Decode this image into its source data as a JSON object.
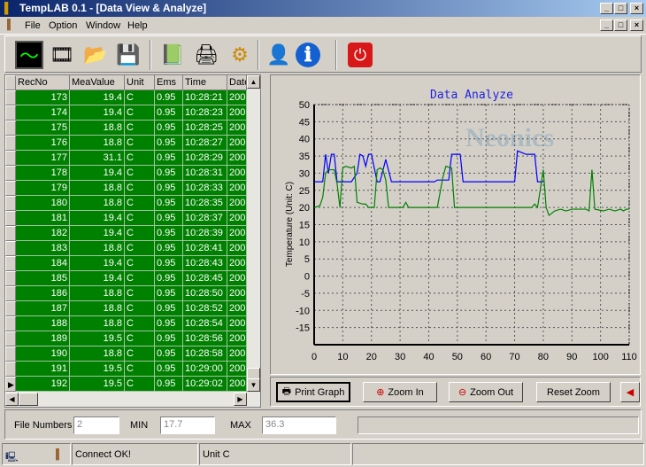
{
  "window": {
    "title": "TempLAB 0.1  - [Data View & Analyze]",
    "controls": [
      "_",
      "□",
      "×"
    ]
  },
  "menu": [
    "File",
    "Option",
    "Window",
    "Help"
  ],
  "toolbar": [
    {
      "icon": "oscilloscope-icon",
      "glyph": "〜"
    },
    {
      "icon": "film-reel-icon",
      "glyph": "🎞"
    },
    {
      "icon": "open-folder-icon",
      "glyph": "📂"
    },
    {
      "icon": "save-disk-icon",
      "glyph": "💾"
    },
    {
      "icon": "excel-export-icon",
      "glyph": "📗"
    },
    {
      "icon": "printer-icon",
      "glyph": "🖨"
    },
    {
      "icon": "settings-gears-icon",
      "glyph": "⚙"
    },
    {
      "icon": "user-report-icon",
      "glyph": "👤"
    },
    {
      "icon": "info-icon",
      "glyph": "ℹ"
    },
    {
      "icon": "power-icon",
      "glyph": "⏻"
    }
  ],
  "grid": {
    "columns": [
      "RecNo",
      "MeaValue",
      "Unit",
      "Ems",
      "Time",
      "Date"
    ],
    "rows": [
      [
        "173",
        "19.4",
        "C",
        "0.95",
        "10:28:21",
        "200"
      ],
      [
        "174",
        "19.4",
        "C",
        "0.95",
        "10:28:23",
        "200"
      ],
      [
        "175",
        "18.8",
        "C",
        "0.95",
        "10:28:25",
        "200"
      ],
      [
        "176",
        "18.8",
        "C",
        "0.95",
        "10:28:27",
        "200"
      ],
      [
        "177",
        "31.1",
        "C",
        "0.95",
        "10:28:29",
        "200"
      ],
      [
        "178",
        "19.4",
        "C",
        "0.95",
        "10:28:31",
        "200"
      ],
      [
        "179",
        "18.8",
        "C",
        "0.95",
        "10:28:33",
        "200"
      ],
      [
        "180",
        "18.8",
        "C",
        "0.95",
        "10:28:35",
        "200"
      ],
      [
        "181",
        "19.4",
        "C",
        "0.95",
        "10:28:37",
        "200"
      ],
      [
        "182",
        "19.4",
        "C",
        "0.95",
        "10:28:39",
        "200"
      ],
      [
        "183",
        "18.8",
        "C",
        "0.95",
        "10:28:41",
        "200"
      ],
      [
        "184",
        "19.4",
        "C",
        "0.95",
        "10:28:43",
        "200"
      ],
      [
        "185",
        "19.4",
        "C",
        "0.95",
        "10:28:45",
        "200"
      ],
      [
        "186",
        "18.8",
        "C",
        "0.95",
        "10:28:50",
        "200"
      ],
      [
        "187",
        "18.8",
        "C",
        "0.95",
        "10:28:52",
        "200"
      ],
      [
        "188",
        "18.8",
        "C",
        "0.95",
        "10:28:54",
        "200"
      ],
      [
        "189",
        "19.5",
        "C",
        "0.95",
        "10:28:56",
        "200"
      ],
      [
        "190",
        "18.8",
        "C",
        "0.95",
        "10:28:58",
        "200"
      ],
      [
        "191",
        "19.5",
        "C",
        "0.95",
        "10:29:00",
        "200"
      ],
      [
        "192",
        "19.5",
        "C",
        "0.95",
        "10:29:02",
        "200"
      ]
    ],
    "row_color": "#008000"
  },
  "chart_data": {
    "type": "line",
    "title": "Data Analyze",
    "ylabel": "Temperature    (Unit: C)",
    "xlim": [
      0,
      110
    ],
    "ylim": [
      -20,
      50
    ],
    "xticks": [
      0,
      10,
      20,
      30,
      40,
      50,
      60,
      70,
      80,
      90,
      100,
      110
    ],
    "yticks": [
      50,
      45,
      40,
      35,
      30,
      25,
      20,
      15,
      10,
      5,
      0,
      -5,
      -10,
      -15
    ],
    "grid": true,
    "watermark": "Neonics",
    "series": [
      {
        "color": "#0000ff",
        "points": [
          [
            0,
            27.5
          ],
          [
            3,
            27.5
          ],
          [
            4,
            35.5
          ],
          [
            5,
            30
          ],
          [
            6,
            35.5
          ],
          [
            7,
            35.5
          ],
          [
            8,
            27.5
          ],
          [
            13,
            27.5
          ],
          [
            15,
            30
          ],
          [
            16,
            35.5
          ],
          [
            17,
            35
          ],
          [
            18,
            32
          ],
          [
            19,
            35.5
          ],
          [
            20,
            35.5
          ],
          [
            22,
            27.5
          ],
          [
            23,
            27.5
          ],
          [
            25,
            34
          ],
          [
            27,
            27.5
          ],
          [
            42,
            27.5
          ],
          [
            43,
            28
          ],
          [
            47,
            28
          ],
          [
            48,
            35.5
          ],
          [
            51,
            35.5
          ],
          [
            52,
            27.5
          ],
          [
            70,
            27.5
          ],
          [
            71,
            36.5
          ],
          [
            74,
            35.5
          ],
          [
            77,
            35.5
          ],
          [
            78,
            27.5
          ],
          [
            80,
            27.5
          ]
        ]
      },
      {
        "color": "#008000",
        "points": [
          [
            0,
            20
          ],
          [
            2,
            20.5
          ],
          [
            3,
            23
          ],
          [
            4,
            30
          ],
          [
            5,
            31
          ],
          [
            7,
            31
          ],
          [
            8,
            27
          ],
          [
            9,
            20
          ],
          [
            10,
            31.5
          ],
          [
            11,
            32
          ],
          [
            13,
            31.5
          ],
          [
            14,
            32
          ],
          [
            15,
            21.5
          ],
          [
            17,
            21
          ],
          [
            18,
            21
          ],
          [
            19,
            20
          ],
          [
            21,
            20
          ],
          [
            22,
            31
          ],
          [
            23,
            31.5
          ],
          [
            24,
            31
          ],
          [
            25,
            28
          ],
          [
            26,
            20
          ],
          [
            31,
            20
          ],
          [
            32,
            21.5
          ],
          [
            33,
            20
          ],
          [
            43,
            20
          ],
          [
            45,
            29
          ],
          [
            46,
            32
          ],
          [
            48,
            31.5
          ],
          [
            49,
            20
          ],
          [
            76,
            20
          ],
          [
            77,
            21
          ],
          [
            78,
            20
          ],
          [
            80,
            31
          ],
          [
            81,
            20
          ],
          [
            82,
            17.7
          ],
          [
            84,
            19
          ],
          [
            86,
            19.5
          ],
          [
            88,
            19
          ],
          [
            90,
            19.5
          ],
          [
            95,
            19.5
          ],
          [
            96,
            19
          ],
          [
            97,
            31
          ],
          [
            98,
            19.5
          ],
          [
            101,
            19
          ],
          [
            103,
            19.5
          ],
          [
            105,
            19
          ],
          [
            107,
            19.5
          ],
          [
            108,
            19
          ],
          [
            109,
            19.5
          ],
          [
            110,
            19.5
          ]
        ]
      }
    ]
  },
  "buttons": {
    "print": "Print Graph",
    "zoom_in": "Zoom In",
    "zoom_out": "Zoom Out",
    "reset": "Reset Zoom"
  },
  "info": {
    "file_numbers_label": "File Numbers",
    "file_numbers": "2",
    "min_label": "MIN",
    "min": "17.7",
    "max_label": "MAX",
    "max": "36.3"
  },
  "status": {
    "connection": "Connect OK!",
    "unit": "Unit C"
  }
}
